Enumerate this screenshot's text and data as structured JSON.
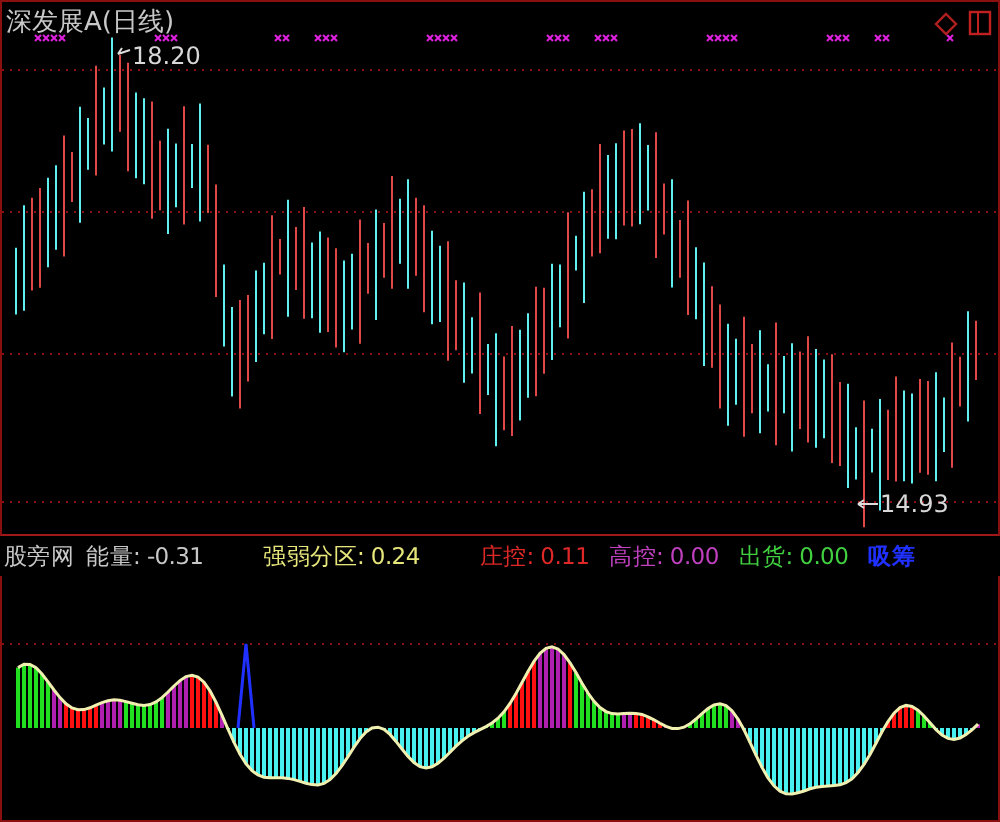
{
  "chart": {
    "title": "深发展A(日线)",
    "high_label": "18.20",
    "low_label": "14.93"
  },
  "indicator": {
    "name": "股旁网",
    "items": [
      {
        "text": "能量: -0.31",
        "color": "#c8c8c8"
      },
      {
        "text": "强弱分区: 0.24",
        "color": "#e6e67a"
      },
      {
        "text": "庄控: 0.11",
        "color": "#e02828"
      },
      {
        "text": "高控: 0.00",
        "color": "#c040c0"
      },
      {
        "text": "出货: 0.00",
        "color": "#40d040"
      },
      {
        "text": "吸筹",
        "color": "#2030ff"
      }
    ]
  }
}
